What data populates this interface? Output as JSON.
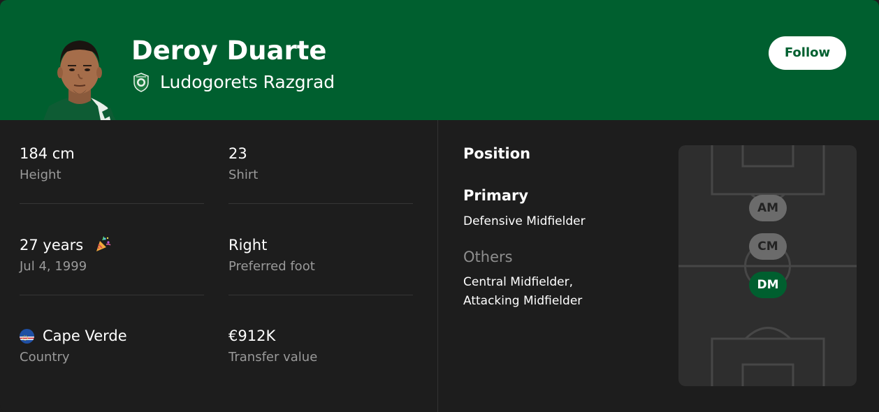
{
  "player": {
    "name": "Deroy Duarte",
    "club": "Ludogorets Razgrad",
    "follow_label": "Follow"
  },
  "stats": {
    "height": {
      "value": "184 cm",
      "label": "Height"
    },
    "shirt": {
      "value": "23",
      "label": "Shirt"
    },
    "age": {
      "value": "27 years",
      "label": "Jul 4, 1999"
    },
    "foot": {
      "value": "Right",
      "label": "Preferred foot"
    },
    "country": {
      "value": "Cape Verde",
      "label": "Country"
    },
    "transfer": {
      "value": "€912K",
      "label": "Transfer value"
    }
  },
  "position": {
    "title": "Position",
    "primary_title": "Primary",
    "primary_value": "Defensive Midfielder",
    "others_title": "Others",
    "others_lines": [
      "Central Midfielder,",
      "Attacking Midfielder"
    ],
    "pitch_markers": [
      {
        "code": "AM",
        "kind": "other"
      },
      {
        "code": "CM",
        "kind": "other"
      },
      {
        "code": "DM",
        "kind": "primary"
      }
    ]
  },
  "icons": {
    "avatar": "player-photo",
    "club": "club-crest-icon",
    "birthday": "party-popper-icon",
    "flag": "cape-verde-flag-icon"
  },
  "colors": {
    "header_bg": "#005f2f",
    "card_bg": "#1d1d1d",
    "pitch_bg": "#2e2e2e",
    "primary_marker": "#005f2f",
    "other_marker": "#6b6b6b"
  }
}
